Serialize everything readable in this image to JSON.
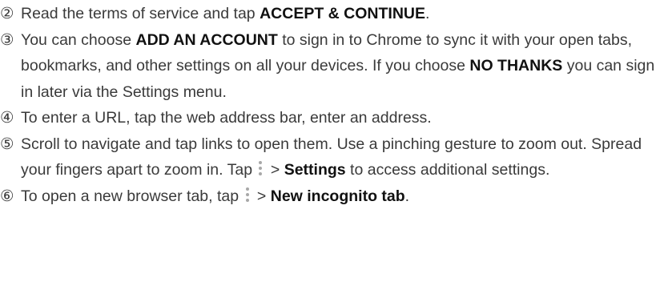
{
  "steps": [
    {
      "num": "②",
      "segments": [
        {
          "t": "Read the terms of service and tap "
        },
        {
          "t": "ACCEPT & CONTINUE",
          "b": true
        },
        {
          "t": "."
        }
      ]
    },
    {
      "num": "③",
      "segments": [
        {
          "t": "You can choose "
        },
        {
          "t": "ADD AN ACCOUNT",
          "b": true
        },
        {
          "t": " to sign in to Chrome to sync it with your open tabs, bookmarks, and other settings on all your devices. If you choose "
        },
        {
          "t": "NO THANKS",
          "b": true
        },
        {
          "t": " you can sign in later via the Settings menu."
        }
      ]
    },
    {
      "num": "④",
      "segments": [
        {
          "t": "To enter a URL, tap the web address bar, enter an address."
        }
      ]
    },
    {
      "num": "⑤",
      "segments": [
        {
          "t": "Scroll to navigate and tap links to open them. Use a pinching gesture to zoom out. Spread your fingers apart to zoom in. Tap "
        },
        {
          "icon": "more-vert-icon"
        },
        {
          "t": " > "
        },
        {
          "t": "Settings",
          "b": true
        },
        {
          "t": " to access additional settings."
        }
      ]
    },
    {
      "num": "⑥",
      "segments": [
        {
          "t": "To open a new browser tab, tap "
        },
        {
          "icon": "more-vert-icon"
        },
        {
          "t": " > "
        },
        {
          "t": "New incognito tab",
          "b": true
        },
        {
          "t": "."
        }
      ]
    }
  ]
}
